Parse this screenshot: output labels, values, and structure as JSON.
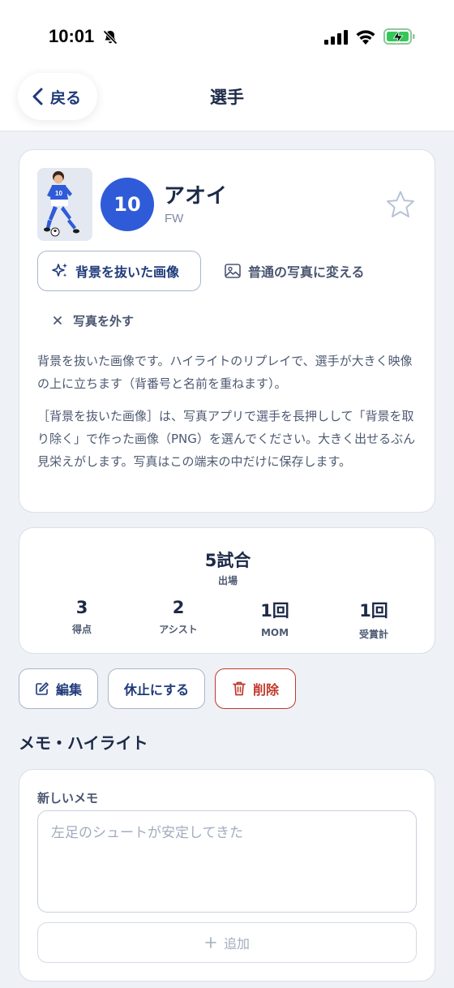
{
  "status_bar": {
    "time": "10:01",
    "icons": [
      "bell-slash-icon",
      "signal-icon",
      "wifi-icon",
      "battery-charging-icon"
    ]
  },
  "nav": {
    "back_label": "戻る",
    "title": "選手"
  },
  "player": {
    "number": "10",
    "name": "アオイ",
    "position": "FW",
    "favorite": false,
    "photo_icon": "player-photo"
  },
  "photo_actions": {
    "cutout_label": "背景を抜いた画像",
    "normal_label": "普通の写真に変える",
    "remove_label": "写真を外す"
  },
  "description": {
    "para1": "背景を抜いた画像です。ハイライトのリプレイで、選手が大きく映像の上に立ちます（背番号と名前を重ねます）。",
    "para2": "［背景を抜いた画像］は、写真アプリで選手を長押しして「背景を取り除く」で作った画像（PNG）を選んでください。大きく出せるぶん見栄えがします。写真はこの端末の中だけに保存します。"
  },
  "stats": {
    "matches": "5試合",
    "matches_label": "出場",
    "items": [
      {
        "value": "3",
        "label": "得点"
      },
      {
        "value": "2",
        "label": "アシスト"
      },
      {
        "value": "1回",
        "label": "MOM"
      },
      {
        "value": "1回",
        "label": "受賞計"
      }
    ]
  },
  "actions": {
    "edit_label": "編集",
    "pause_label": "休止にする",
    "delete_label": "削除"
  },
  "memo": {
    "section_title": "メモ・ハイライト",
    "new_memo_label": "新しいメモ",
    "placeholder": "左足のシュートが安定してきた",
    "value": "",
    "add_label": "追加"
  },
  "colors": {
    "accent": "#2f5bd8",
    "danger": "#c0392b",
    "background": "#eef1f6",
    "text_primary": "#1c2a48"
  }
}
